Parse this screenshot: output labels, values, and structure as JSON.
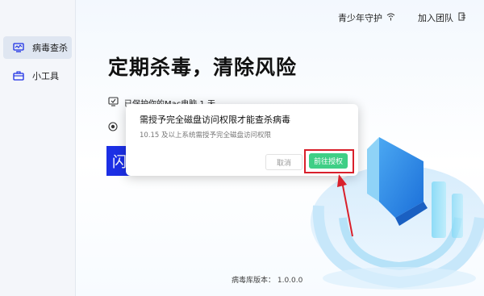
{
  "sidebar": {
    "items": [
      {
        "label": "病毒查杀",
        "icon": "monitor-icon",
        "active": true
      },
      {
        "label": "小工具",
        "icon": "toolbox-icon",
        "active": false
      }
    ]
  },
  "topbar": {
    "youth_mode": "青少年守护",
    "join_team": "加入团队"
  },
  "main": {
    "headline": "定期杀毒，清除风险",
    "protect_text": "已保护你的Mac电脑 1 天",
    "scan_button_char": "闪",
    "version_label": "病毒库版本： 1.0.0.0"
  },
  "dialog": {
    "title": "需授予完全磁盘访问权限才能查杀病毒",
    "subtitle": "10.15 及以上系统需授予完全磁盘访问权限",
    "cancel_label": "取消",
    "confirm_label": "前往授权"
  },
  "colors": {
    "accent_blue": "#1c2fe5",
    "confirm_green": "#3fcf86",
    "highlight_red": "#d9202b"
  }
}
